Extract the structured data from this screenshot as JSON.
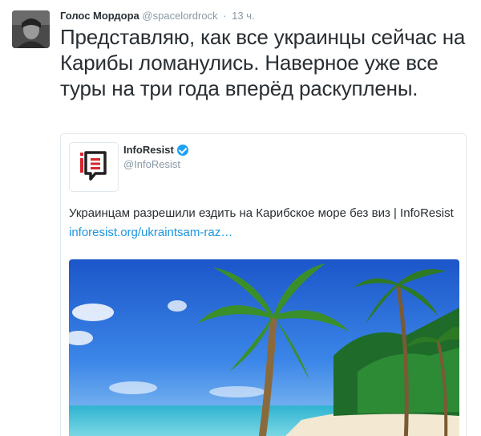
{
  "tweet": {
    "display_name": "Голос Мордора",
    "handle": "@spacelordrock",
    "separator": "·",
    "time": "13 ч.",
    "text": "Представляю, как все украинцы сейчас на Карибы ломанулись. Наверное уже все туры на три года вперёд раскуплены."
  },
  "quoted": {
    "name": "InfoResist",
    "handle": "@InfoResist",
    "text": "Украинцам разрешили ездить на Карибское море без виз | InfoResist",
    "link": "inforesist.org/ukraintsam-raz…"
  },
  "colors": {
    "link": "#1b95e0",
    "verified": "#1da1f2",
    "brand_red": "#d7262e"
  }
}
